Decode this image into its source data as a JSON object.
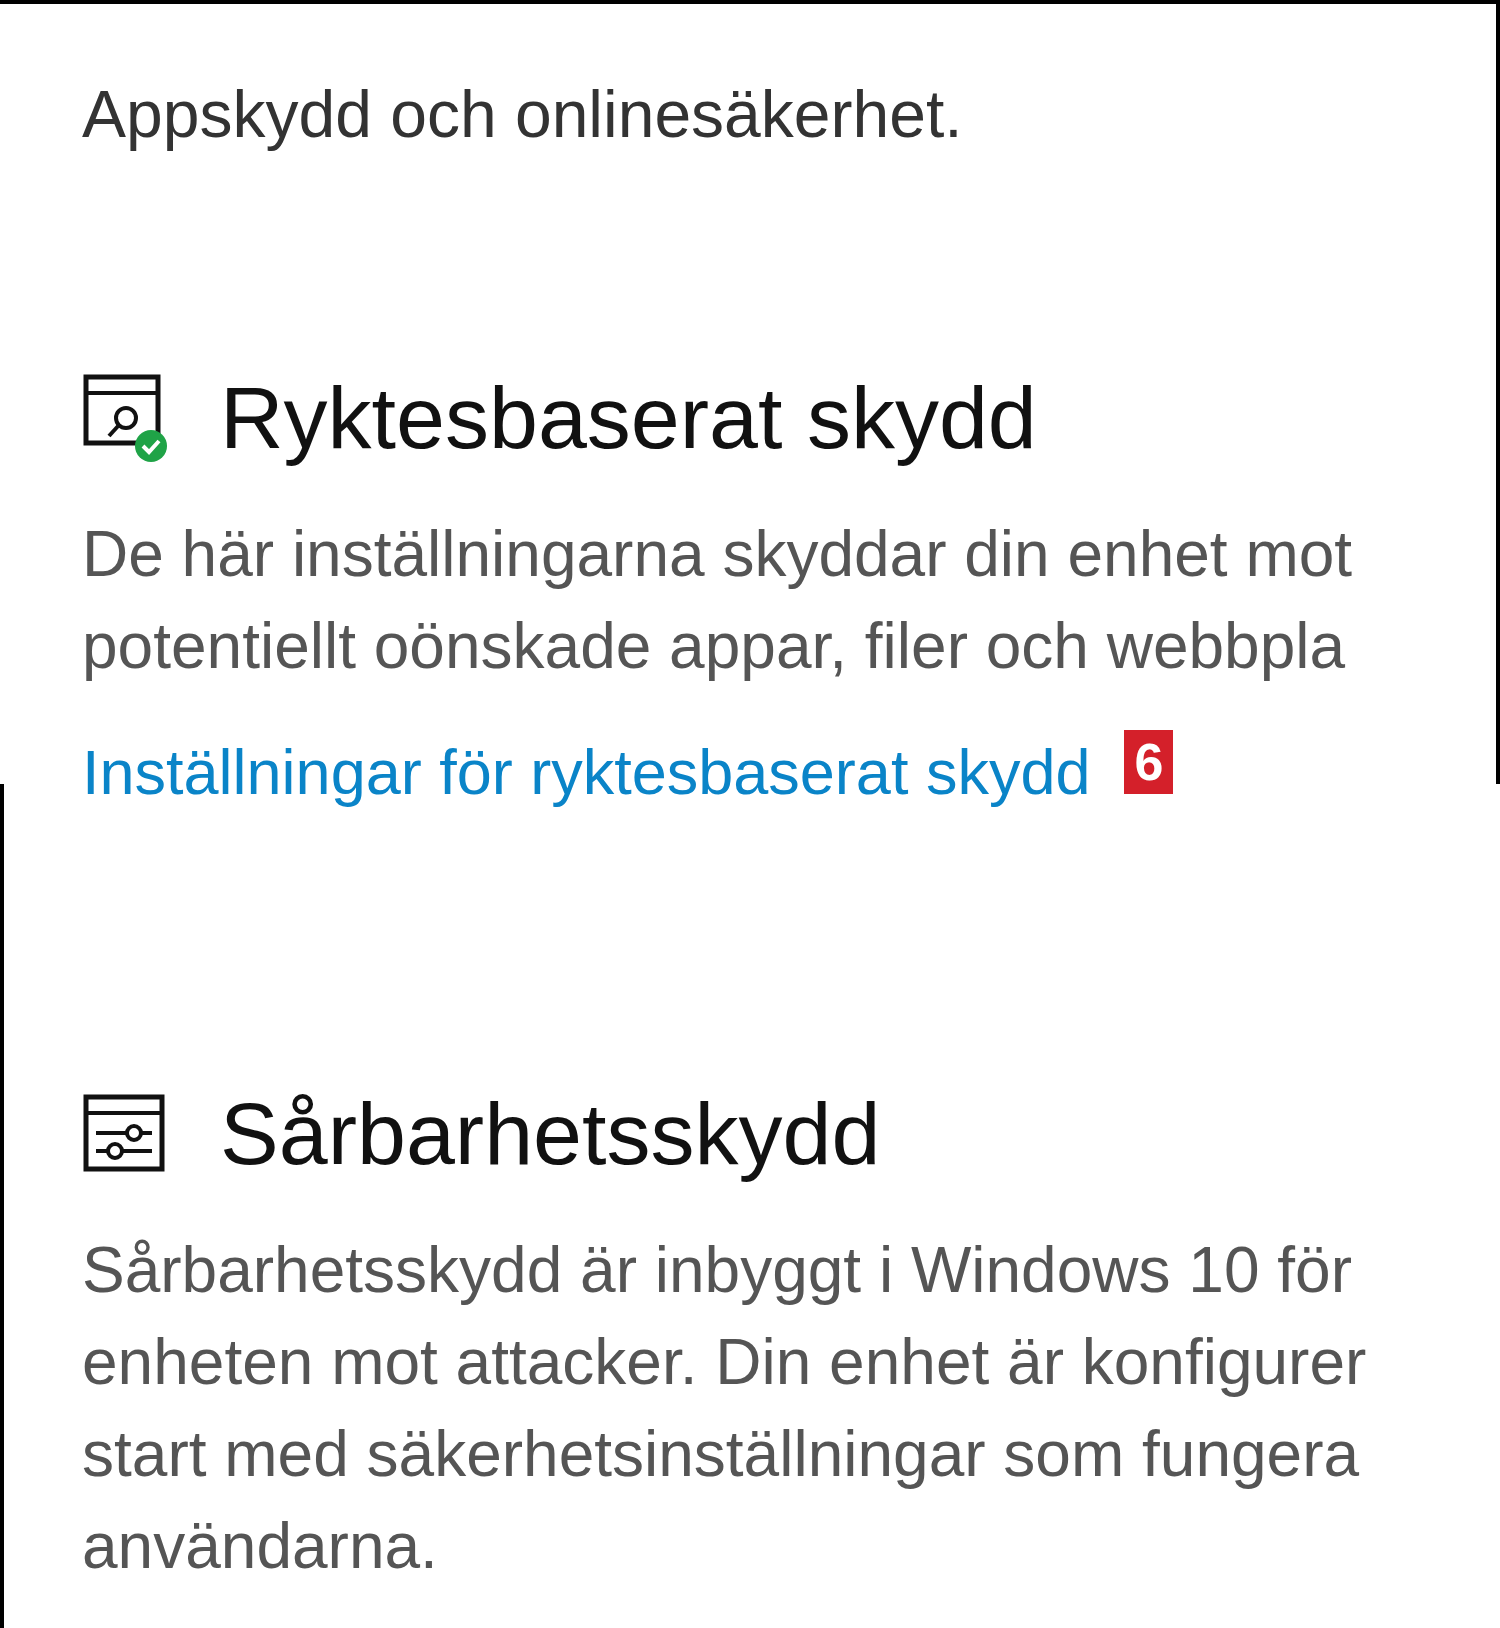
{
  "intro": "Appskydd och onlinesäkerhet.",
  "sections": [
    {
      "kind": "reputation",
      "title": "Ryktesbaserat skydd",
      "description_lines": [
        "De här inställningarna skyddar din enhet mot",
        "potentiellt oönskade appar, filer och webbpla"
      ],
      "link": "Inställningar för ryktesbaserat skydd",
      "badge": "6"
    },
    {
      "kind": "vulnerability",
      "title": "Sårbarhetsskydd",
      "description_lines": [
        "Sårbarhetsskydd är inbyggt i Windows 10 för",
        "enheten mot attacker. Din enhet är konfigurer",
        "start med säkerhetsinställningar som fungera",
        "användarna."
      ]
    }
  ]
}
